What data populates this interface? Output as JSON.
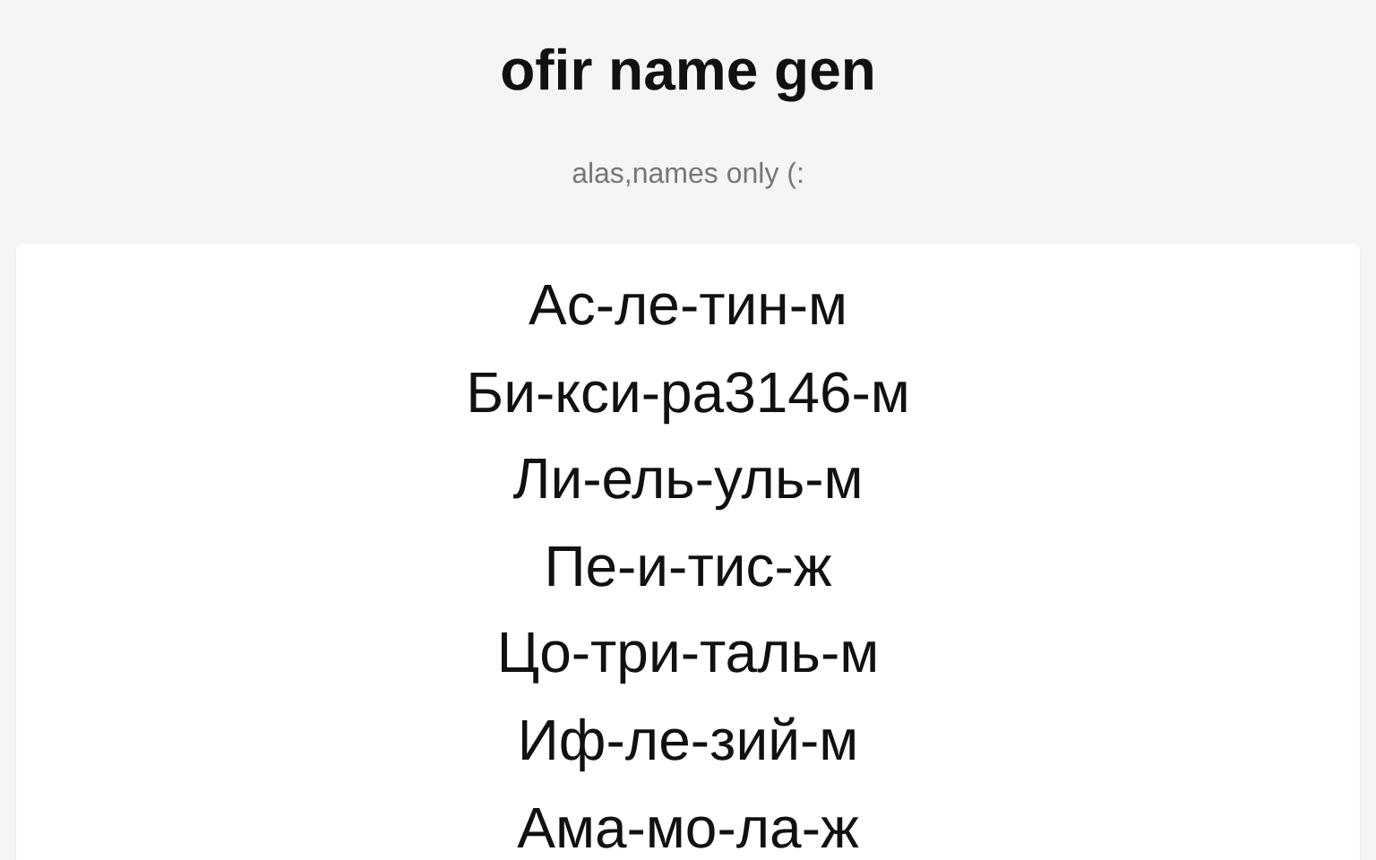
{
  "header": {
    "title": "ofir name gen",
    "subtitle": "alas,names only (:"
  },
  "names": [
    "Ас-ле-тин-м",
    "Би-кси-ра3146-м",
    "Ли-ель-уль-м",
    "Пе-и-тис-ж",
    "Цо-три-таль-м",
    "Иф-ле-зий-м",
    "Ама-мо-ла-ж"
  ]
}
